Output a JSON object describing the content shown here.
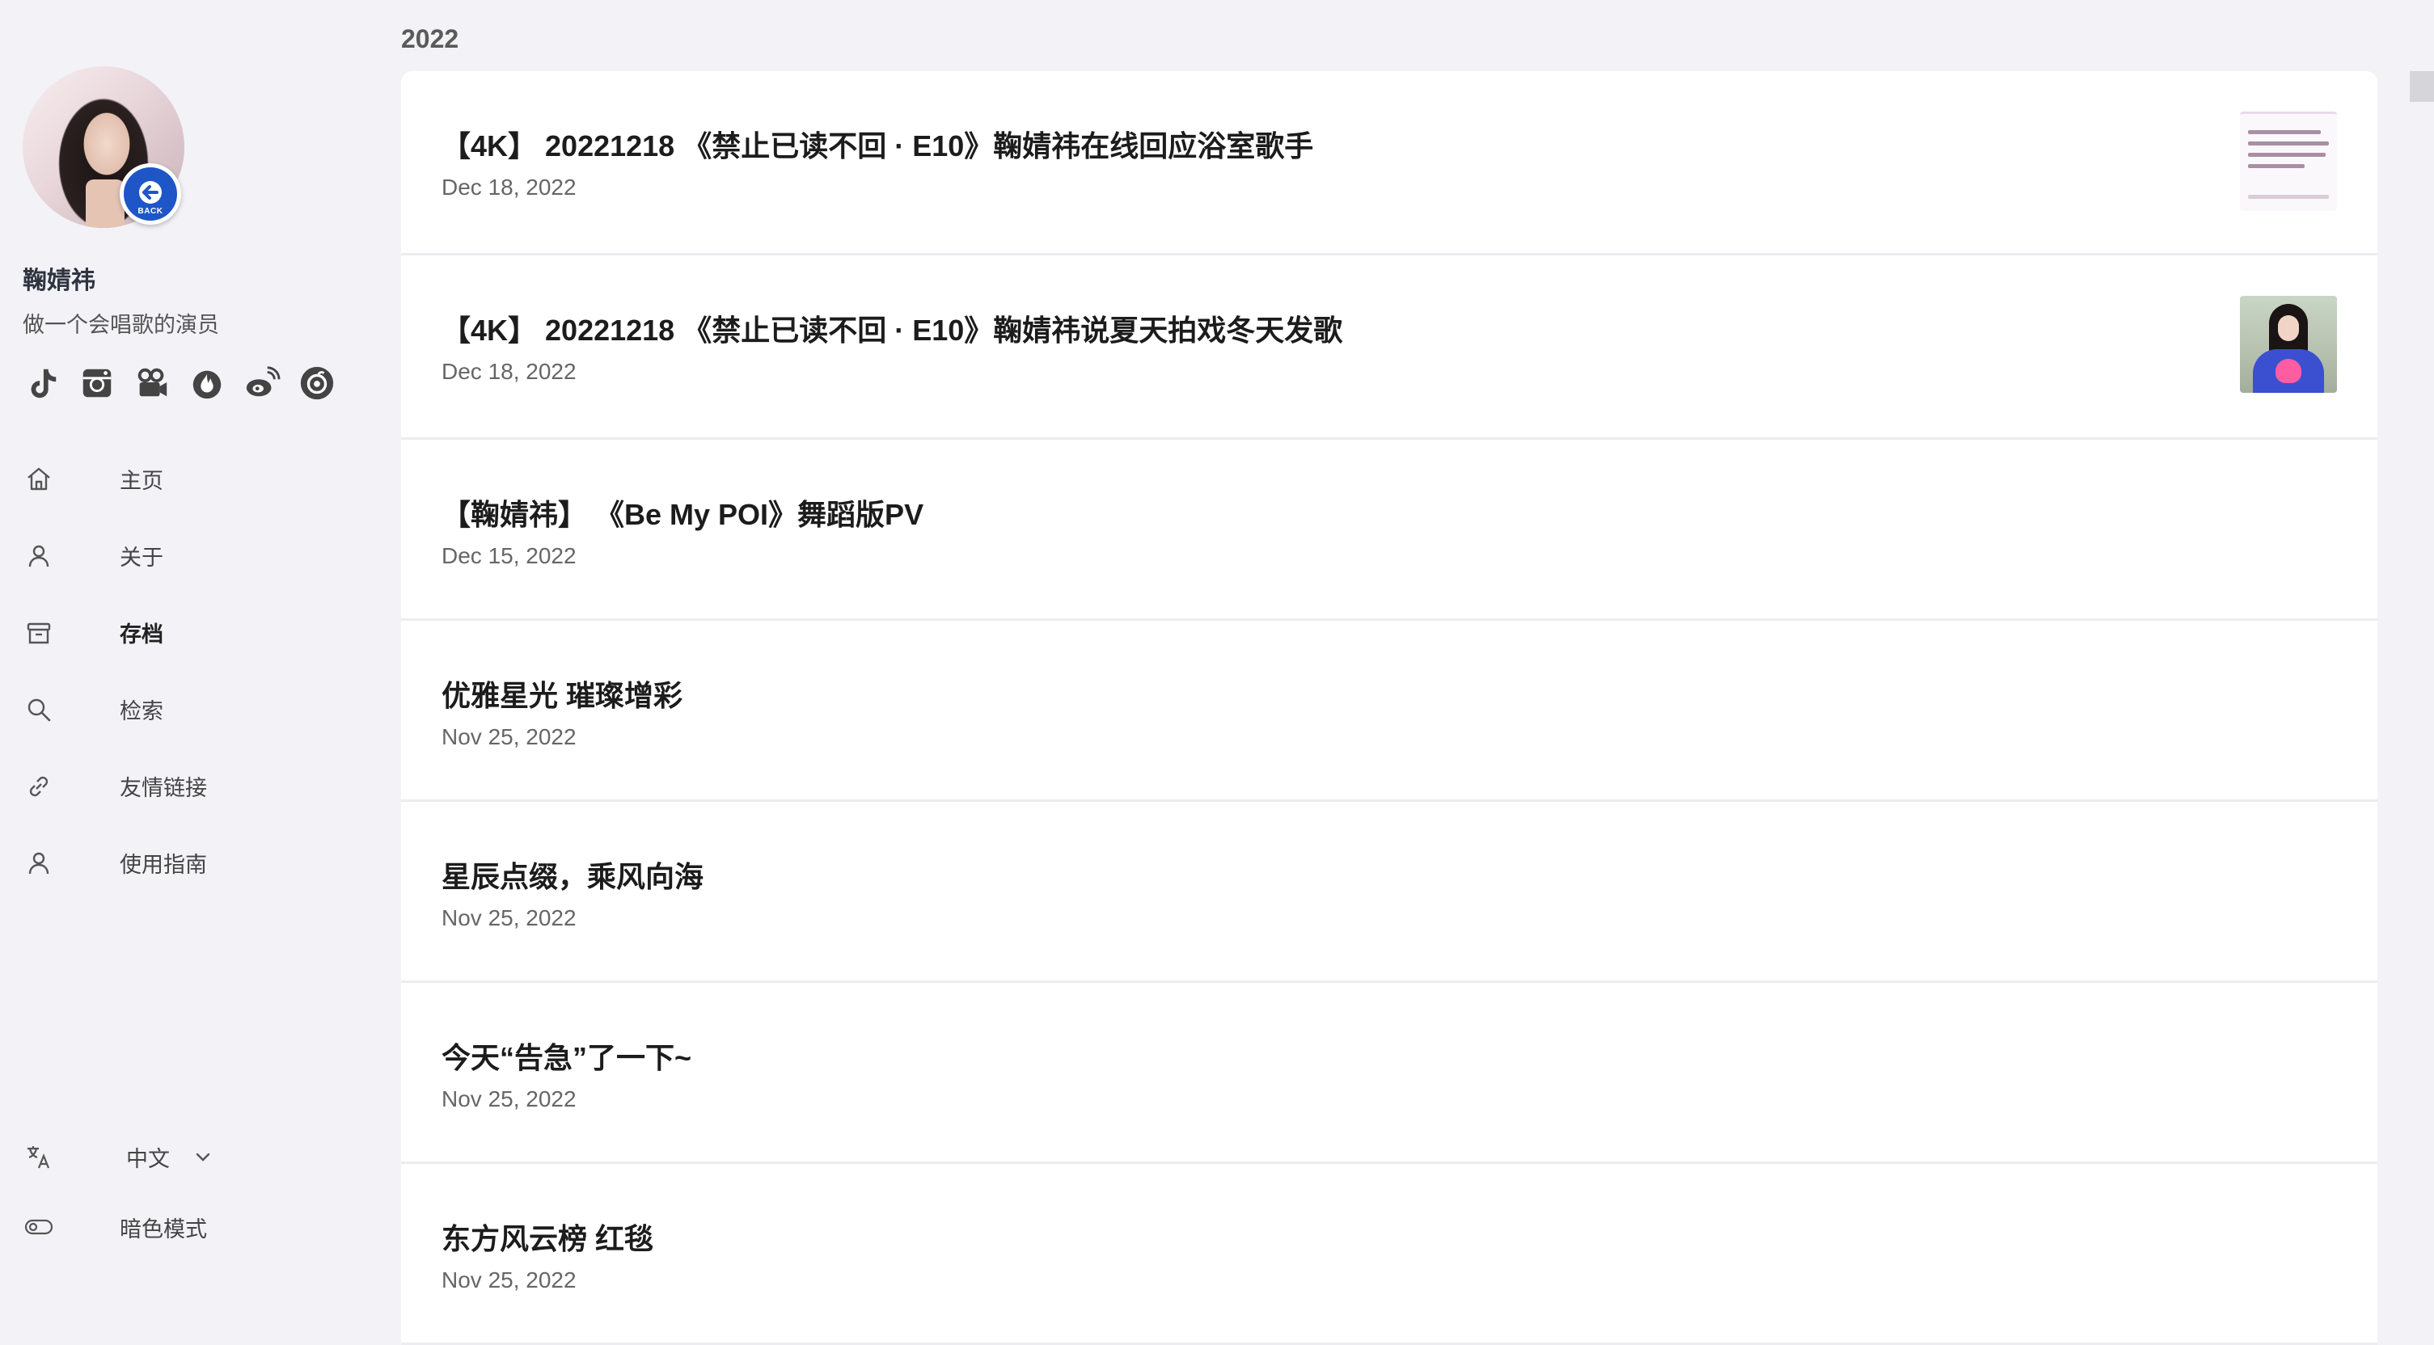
{
  "profile": {
    "name": "鞠婧祎",
    "bio": "做一个会唱歌的演员",
    "avatar_badge": "BACK"
  },
  "socials": [
    {
      "icon": "tiktok-icon"
    },
    {
      "icon": "instagram-icon"
    },
    {
      "icon": "video-camera-icon"
    },
    {
      "icon": "flame-icon"
    },
    {
      "icon": "weibo-icon"
    },
    {
      "icon": "netease-music-icon"
    }
  ],
  "nav": [
    {
      "label": "主页",
      "icon": "home-icon"
    },
    {
      "label": "关于",
      "icon": "user-icon"
    },
    {
      "label": "存档",
      "icon": "archive-icon",
      "active": true
    },
    {
      "label": "检索",
      "icon": "search-icon"
    },
    {
      "label": "友情链接",
      "icon": "link-icon"
    },
    {
      "label": "使用指南",
      "icon": "user-icon"
    }
  ],
  "language": {
    "label": "中文",
    "icon": "translate-icon"
  },
  "dark_mode": {
    "label": "暗色模式",
    "icon": "toggle-icon"
  },
  "archive": {
    "year": "2022",
    "posts": [
      {
        "title": "【4K】 20221218 《禁止已读不回 · E10》鞠婧祎在线回应浴室歌手",
        "date": "Dec 18, 2022",
        "thumbnail": "text-screenshot"
      },
      {
        "title": "【4K】 20221218 《禁止已读不回 · E10》鞠婧祎说夏天拍戏冬天发歌",
        "date": "Dec 18, 2022",
        "thumbnail": "photo"
      },
      {
        "title": "【鞠婧祎】 《Be My POI》舞蹈版PV",
        "date": "Dec 15, 2022"
      },
      {
        "title": "优雅星光 璀璨增彩",
        "date": "Nov 25, 2022"
      },
      {
        "title": "星辰点缀，乘风向海",
        "date": "Nov 25, 2022"
      },
      {
        "title": "今天“告急”了一下~",
        "date": "Nov 25, 2022"
      },
      {
        "title": "东方风云榜 红毯",
        "date": "Nov 25, 2022"
      }
    ]
  },
  "colors": {
    "background": "#f3f2f7",
    "card": "#ffffff",
    "badge_blue": "#1e56c8"
  }
}
